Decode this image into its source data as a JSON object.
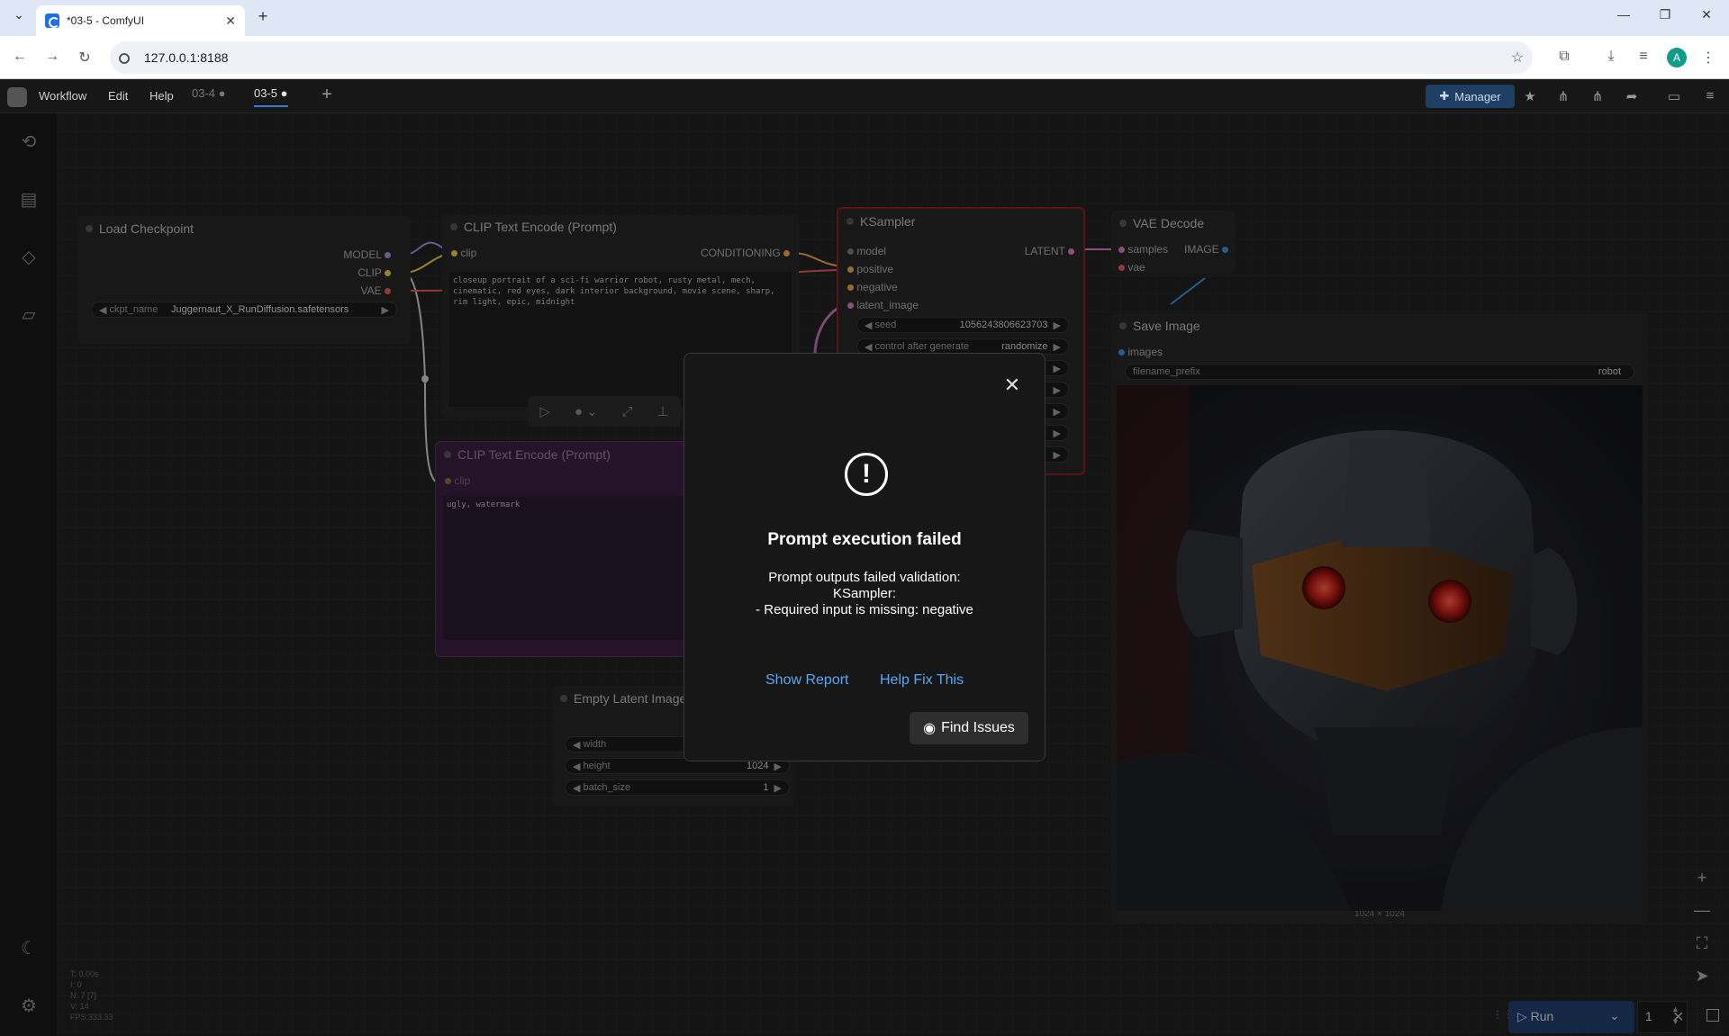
{
  "browser": {
    "tab_title": "*03-5 - ComfyUI",
    "url": "127.0.0.1:8188",
    "avatar_letter": "A"
  },
  "menu": {
    "items": [
      "Workflow",
      "Edit",
      "Help"
    ],
    "workflow_tabs": [
      "03-4",
      "03-5"
    ],
    "manager_label": "Manager"
  },
  "nodes": {
    "load_checkpoint": {
      "title": "Load Checkpoint",
      "outputs": [
        "MODEL",
        "CLIP",
        "VAE"
      ],
      "ckpt_label": "ckpt_name",
      "ckpt_value": "Juggernaut_X_RunDiffusion.safetensors"
    },
    "clip_pos": {
      "title": "CLIP Text Encode (Prompt)",
      "input": "clip",
      "output": "CONDITIONING",
      "text": "closeup portrait of a sci-fi warrior robot, rusty metal, mech, cinematic, red eyes, dark interior background, movie scene, sharp, rim light, epic, midnight"
    },
    "clip_neg": {
      "title": "CLIP Text Encode (Prompt)",
      "input": "clip",
      "text": "ugly, watermark"
    },
    "ksampler": {
      "title": "KSampler",
      "inputs": [
        "model",
        "positive",
        "negative",
        "latent_image"
      ],
      "output": "LATENT",
      "seed_label": "seed",
      "seed_value": "1056243806623703",
      "control_label": "control after generate",
      "control_value": "randomize"
    },
    "vae_decode": {
      "title": "VAE Decode",
      "inputs": [
        "samples",
        "vae"
      ],
      "output": "IMAGE"
    },
    "save_image": {
      "title": "Save Image",
      "input": "images",
      "prefix_label": "filename_prefix",
      "prefix_value": "robot",
      "size_caption": "1024 × 1024"
    },
    "empty_latent": {
      "title": "Empty Latent Image",
      "width_label": "width",
      "height_label": "height",
      "height_value": "1024",
      "batch_label": "batch_size",
      "batch_value": "1"
    }
  },
  "dialog": {
    "title": "Prompt execution failed",
    "line1": "Prompt outputs failed validation:",
    "line2": "KSampler:",
    "line3": "- Required input is missing: negative",
    "show_report": "Show Report",
    "help_fix": "Help Fix This",
    "find_issues": "Find Issues"
  },
  "stats": [
    "T: 0.00s",
    "I: 0",
    "N: 7 [7]",
    "V: 14",
    "FPS:333.33"
  ],
  "run": {
    "label": "Run",
    "count": "1"
  },
  "colors": {
    "accent": "#3c7bd4",
    "link": "#5aa7f2",
    "ksampler_border": "#8a1c1c",
    "negative_node": "#3a1f3f"
  }
}
